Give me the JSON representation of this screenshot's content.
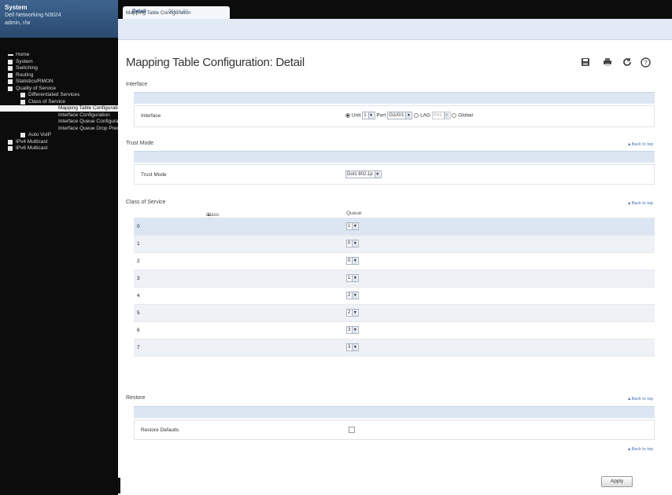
{
  "system": {
    "label": "System",
    "device": "Dell Networking N3024",
    "user": "admin, r/w"
  },
  "tree": [
    {
      "label": "Home",
      "indent": 0,
      "kind": "bar"
    },
    {
      "label": "System",
      "indent": 0,
      "kind": "box"
    },
    {
      "label": "Switching",
      "indent": 0,
      "kind": "box"
    },
    {
      "label": "Routing",
      "indent": 0,
      "kind": "box"
    },
    {
      "label": "Statistics/RMON",
      "indent": 0,
      "kind": "box"
    },
    {
      "label": "Quality of Service",
      "indent": 0,
      "kind": "box"
    },
    {
      "label": "Differentiated Services",
      "indent": 1,
      "kind": "box"
    },
    {
      "label": "Class of Service",
      "indent": 1,
      "kind": "box"
    },
    {
      "label": "Mapping Table Configuration",
      "indent": 2,
      "kind": "none",
      "selected": true
    },
    {
      "label": "Interface Configuration",
      "indent": 2,
      "kind": "none"
    },
    {
      "label": "Interface Queue Configuration",
      "indent": 2,
      "kind": "none"
    },
    {
      "label": "Interface Queue Drop Precedence",
      "indent": 2,
      "kind": "none"
    },
    {
      "label": "Auto VoIP",
      "indent": 1,
      "kind": "box"
    },
    {
      "label": "IPv4 Multicast",
      "indent": 0,
      "kind": "box"
    },
    {
      "label": "IPv6 Multicast",
      "indent": 0,
      "kind": "box"
    }
  ],
  "top_tab": "Mapping Table Configuration",
  "subtabs": {
    "active": "Detail",
    "other": "Show All"
  },
  "page_title": "Mapping Table Configuration: Detail",
  "icons": [
    "save-icon",
    "print-icon",
    "refresh-icon",
    "help-icon"
  ],
  "back_to_top": "▲Back to top",
  "interface_section": {
    "title": "Interface",
    "label": "Interface",
    "unit_label": "Unit",
    "unit_value": "1",
    "port_label": "Port",
    "port_value": "Gi1/0/1",
    "lag_label": "LAG",
    "lag_value": "Po1",
    "global_label": "Global",
    "selected": "unit"
  },
  "trust_section": {
    "title": "Trust Mode",
    "label": "Trust Mode",
    "value": "Dot1 802.1p"
  },
  "cos_section": {
    "title": "Class of Service",
    "col1": "Class of Service",
    "col2": "Queue",
    "rows": [
      {
        "cos": "0",
        "queue": "1"
      },
      {
        "cos": "1",
        "queue": "0"
      },
      {
        "cos": "2",
        "queue": "0"
      },
      {
        "cos": "3",
        "queue": "1"
      },
      {
        "cos": "4",
        "queue": "2"
      },
      {
        "cos": "5",
        "queue": "2"
      },
      {
        "cos": "6",
        "queue": "3"
      },
      {
        "cos": "7",
        "queue": "3"
      }
    ]
  },
  "restore_section": {
    "title": "Restore",
    "label": "Restore Defaults"
  },
  "apply_label": "Apply"
}
